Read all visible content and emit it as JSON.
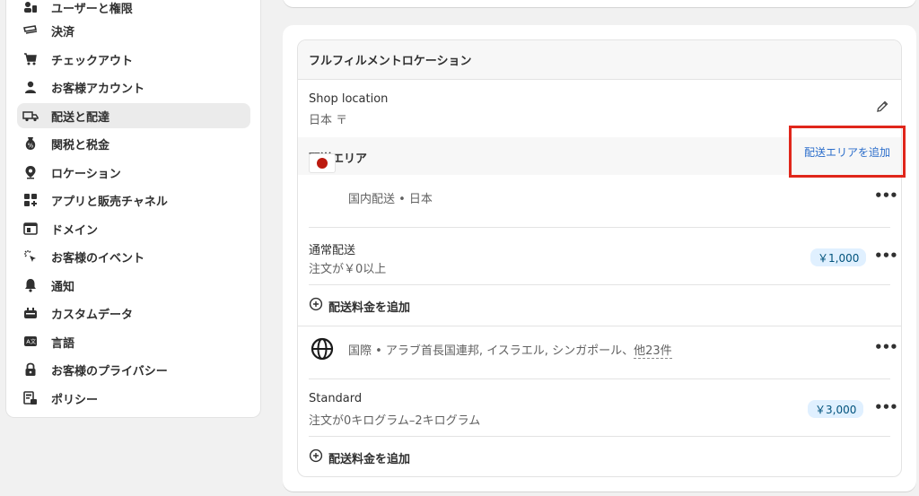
{
  "sidebar": {
    "items": [
      {
        "label": "ユーザーと権限",
        "icon": "users-icon"
      },
      {
        "label": "決済",
        "icon": "payments-icon"
      },
      {
        "label": "チェックアウト",
        "icon": "cart-icon"
      },
      {
        "label": "お客様アカウント",
        "icon": "person-icon"
      },
      {
        "label": "配送と配達",
        "icon": "truck-icon",
        "active": true
      },
      {
        "label": "関税と税金",
        "icon": "tax-icon"
      },
      {
        "label": "ロケーション",
        "icon": "location-pin-icon"
      },
      {
        "label": "アプリと販売チャネル",
        "icon": "apps-icon"
      },
      {
        "label": "ドメイン",
        "icon": "globe-window-icon"
      },
      {
        "label": "お客様のイベント",
        "icon": "cursor-click-icon"
      },
      {
        "label": "通知",
        "icon": "bell-icon"
      },
      {
        "label": "カスタムデータ",
        "icon": "database-icon"
      },
      {
        "label": "言語",
        "icon": "language-icon"
      },
      {
        "label": "お客様のプライバシー",
        "icon": "lock-icon"
      },
      {
        "label": "ポリシー",
        "icon": "policy-icon"
      }
    ]
  },
  "fulfillment": {
    "title": "フルフィルメントロケーション",
    "location_name": "Shop location",
    "location_address": "日本 〒"
  },
  "zones": {
    "title": "配送エリア",
    "add_zone_label": "配送エリアを追加",
    "domestic": {
      "label": "国内配送 • 日本",
      "rate_name": "通常配送",
      "rate_condition": "注文が￥0以上",
      "rate_price": "￥1,000",
      "add_rate_label": "配送料金を追加"
    },
    "international": {
      "label_prefix": "国際 • アラブ首長国連邦, イスラエル, シンガポール、",
      "label_more": "他23件",
      "rate_name": "Standard",
      "rate_condition": "注文が0キログラム–2キログラム",
      "rate_price": "￥3,000",
      "add_rate_label": "配送料金を追加"
    }
  },
  "colors": {
    "accent_red": "#e0261b",
    "link_blue": "#2c6ecb",
    "japan_flag_red": "#bc1a0f"
  }
}
